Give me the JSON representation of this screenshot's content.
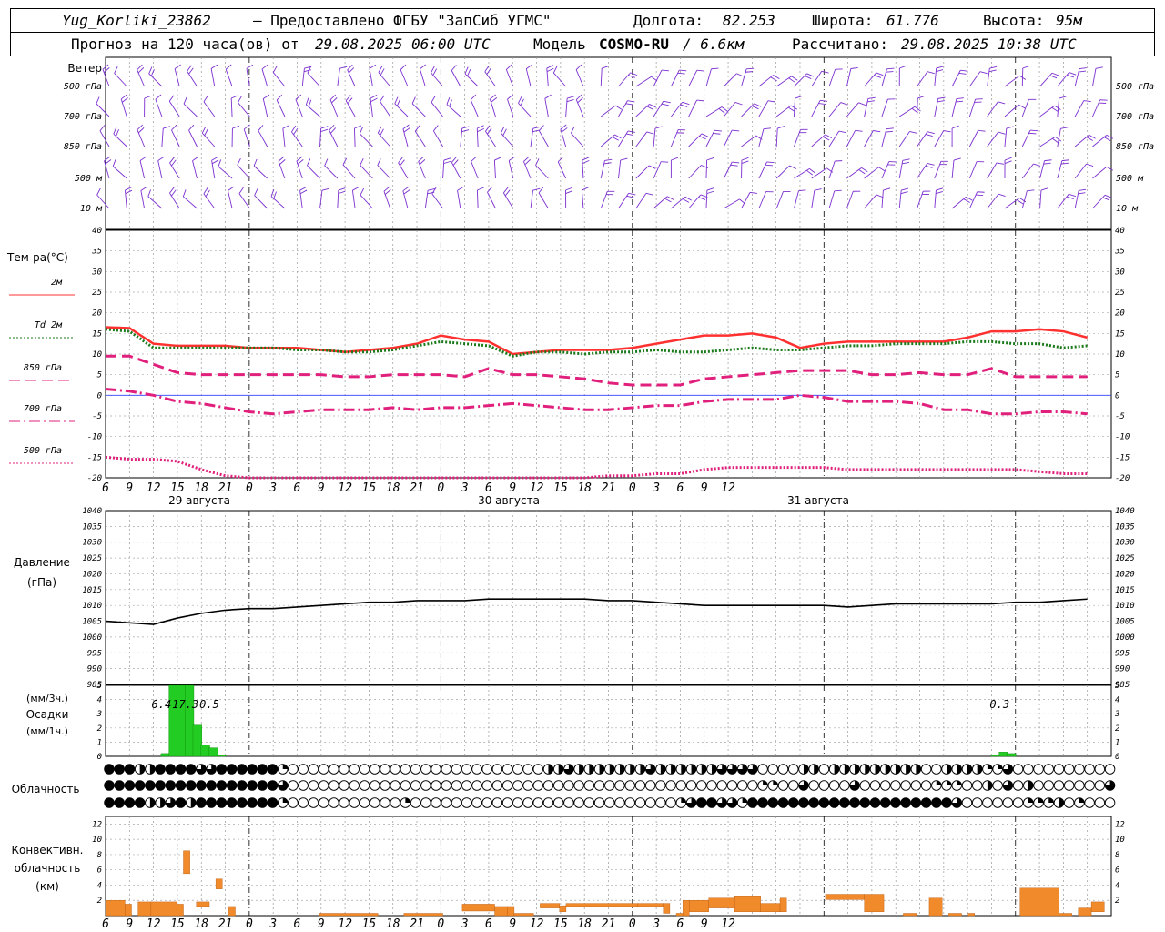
{
  "header": {
    "station": "Yug_Korliki_23862",
    "provider": "– Предоставлено ФГБУ \"ЗапСиб УГМС\"",
    "lon_label": "Долгота:",
    "lon": "82.253",
    "lat_label": "Широта:",
    "lat": "61.776",
    "alt_label": "Высота:",
    "alt": "95м",
    "forecast_prefix": "Прогноз на 120 часа(ов) от",
    "forecast_from": "29.08.2025 06:00 UTC",
    "model_label": "Модель",
    "model": "COSMO-RU",
    "model_res": "/ 6.6км",
    "calc_label": "Рассчитано:",
    "calc_time": "29.08.2025 10:38 UTC"
  },
  "chart_data": [
    {
      "type": "wind-barbs",
      "title": "Ветер",
      "levels": [
        "500 гПа",
        "700 гПа",
        "850 гПа",
        "500 м",
        "10 м"
      ],
      "color": "#7b2fd0"
    },
    {
      "type": "line",
      "ylabel": "Тем-ра(°C)",
      "ylim": [
        -20,
        40
      ],
      "yticks": [
        -20,
        -15,
        -10,
        -5,
        0,
        5,
        10,
        15,
        20,
        25,
        30,
        35,
        40
      ],
      "x_ticks": [
        "6",
        "9",
        "12",
        "15",
        "18",
        "21",
        "0",
        "3",
        "6",
        "9",
        "12",
        "15",
        "18",
        "21",
        "0",
        "3",
        "6",
        "9",
        "12",
        "15",
        "18",
        "21",
        "0",
        "3",
        "6",
        "9",
        "12"
      ],
      "date_labels": [
        "29 августа",
        "30 августа",
        "31 августа"
      ],
      "series": [
        {
          "name": "2м",
          "color": "#ff3030",
          "style": "solid",
          "values": [
            16.5,
            16.3,
            12.5,
            12,
            12,
            12,
            11.5,
            11.5,
            11.5,
            11,
            10.5,
            11,
            11.5,
            12.5,
            14.5,
            13.5,
            13,
            10,
            10.5,
            11,
            11,
            11,
            11.5,
            12.5,
            13.5,
            14.5,
            14.5,
            15,
            14,
            11.5,
            12.5,
            13,
            13,
            13,
            13,
            13,
            14,
            15.5,
            15.5,
            16,
            15.5,
            14
          ]
        },
        {
          "name": "Td 2м",
          "color": "#1a7a1a",
          "style": "dotted",
          "values": [
            16,
            15.5,
            11.5,
            11.5,
            11.5,
            11.5,
            11.5,
            11.5,
            11,
            11,
            10.5,
            10.5,
            11,
            12,
            13,
            12.5,
            12,
            9.5,
            10.5,
            10.5,
            10,
            10.5,
            10.5,
            11,
            10.5,
            10.5,
            11,
            11.5,
            11,
            11,
            11.5,
            12,
            12,
            12.5,
            12.5,
            12.5,
            13,
            13,
            12.5,
            12.5,
            11.5,
            12
          ]
        },
        {
          "name": "850 гПа",
          "color": "#e0207c",
          "style": "dash",
          "values": [
            9.5,
            9.5,
            7.5,
            5.5,
            5,
            5,
            5,
            5,
            5,
            5,
            4.5,
            4.5,
            5,
            5,
            5,
            4.5,
            6.5,
            5,
            5,
            4.5,
            4,
            3,
            2.5,
            2.5,
            2.5,
            4,
            4.5,
            5,
            5.5,
            6,
            6,
            6,
            5,
            5,
            5.5,
            5,
            5,
            6.5,
            4.5,
            4.5,
            4.5,
            4.5
          ]
        },
        {
          "name": "700 гПа",
          "color": "#e0207c",
          "style": "dashdot",
          "values": [
            1.5,
            1,
            0,
            -1.5,
            -2,
            -3,
            -4,
            -4.5,
            -4,
            -3.5,
            -3.5,
            -3.5,
            -3,
            -3.5,
            -3,
            -3,
            -2.5,
            -2,
            -2.5,
            -3,
            -3.5,
            -3.5,
            -3,
            -2.5,
            -2.5,
            -1.5,
            -1,
            -1,
            -1,
            0,
            -0.5,
            -1.5,
            -1.5,
            -1.5,
            -2,
            -3.5,
            -3.5,
            -4.5,
            -4.5,
            -4,
            -4,
            -4.5
          ]
        },
        {
          "name": "500 гПа",
          "color": "#e0207c",
          "style": "dotted",
          "values": [
            -15,
            -15.5,
            -15.5,
            -16,
            -18,
            -19.5,
            -20,
            -20,
            -20,
            -20,
            -20,
            -20,
            -20,
            -20,
            -20,
            -20,
            -20,
            -20,
            -20,
            -20,
            -20,
            -19.5,
            -19.5,
            -19,
            -19,
            -18,
            -17.5,
            -17.5,
            -17.5,
            -17.5,
            -17.5,
            -18,
            -18,
            -18,
            -18,
            -18,
            -18,
            -18,
            -18,
            -18.5,
            -19,
            -19
          ]
        }
      ]
    },
    {
      "type": "line",
      "ylabel": "Давление",
      "yunit": "(гПа)",
      "ylim": [
        985,
        1040
      ],
      "yticks": [
        985,
        990,
        995,
        1000,
        1005,
        1010,
        1015,
        1020,
        1025,
        1030,
        1035,
        1040
      ],
      "series": [
        {
          "name": "Давление",
          "color": "#000000",
          "values": [
            1005,
            1004.5,
            1004,
            1006,
            1007.5,
            1008.5,
            1009,
            1009,
            1009.5,
            1010,
            1010.5,
            1011,
            1011,
            1011.5,
            1011.5,
            1011.5,
            1012,
            1012,
            1012,
            1012,
            1012,
            1011.5,
            1011.5,
            1011,
            1010.5,
            1010,
            1010,
            1010,
            1010,
            1010,
            1010,
            1009.5,
            1010,
            1010.5,
            1010.5,
            1010.5,
            1010.5,
            1010.5,
            1011,
            1011,
            1011.5,
            1012
          ]
        }
      ]
    },
    {
      "type": "bar",
      "ylabel": "(мм/3ч.)",
      "ylabel2": "Осадки",
      "ylabel3": "(мм/1ч.)",
      "ylim": [
        0,
        5
      ],
      "yticks": [
        0,
        1,
        2,
        3,
        4,
        5
      ],
      "color": "#22cc22",
      "annotations": [
        {
          "x_hour": 7.0,
          "text": "6.4"
        },
        {
          "x_hour": 10.0,
          "text": "17.3"
        },
        {
          "x_hour": 13.0,
          "text": "0.5"
        },
        {
          "x_hour": 112.0,
          "text": "0.3"
        }
      ],
      "bars": [
        {
          "h": 7,
          "v": 0.2
        },
        {
          "h": 8,
          "v": 5
        },
        {
          "h": 9,
          "v": 5
        },
        {
          "h": 10,
          "v": 5
        },
        {
          "h": 11,
          "v": 2.2
        },
        {
          "h": 12,
          "v": 0.8
        },
        {
          "h": 13,
          "v": 0.6
        },
        {
          "h": 14,
          "v": 0.1
        },
        {
          "h": 111,
          "v": 0.1
        },
        {
          "h": 112,
          "v": 0.3
        },
        {
          "h": 113,
          "v": 0.2
        }
      ]
    },
    {
      "type": "cloud-cover",
      "ylabel": "Облачность",
      "rows": [
        [
          8,
          8,
          8,
          4,
          4,
          8,
          8,
          8,
          8,
          6,
          6,
          8,
          8,
          8,
          8,
          8,
          8,
          2,
          0,
          0,
          0,
          0,
          0,
          0,
          0,
          0,
          0,
          0,
          0,
          0,
          0,
          0,
          0,
          0,
          0,
          0,
          0,
          0,
          0,
          0,
          0,
          0,
          0,
          4,
          4,
          6,
          4,
          4,
          4,
          4,
          4,
          4,
          4,
          6,
          4,
          4,
          4,
          4,
          4,
          4,
          6,
          6,
          6,
          6,
          0,
          0,
          0,
          0,
          4,
          4,
          0,
          4,
          4,
          4,
          4,
          4,
          4,
          4,
          4,
          4,
          0,
          0,
          4,
          4,
          4,
          4,
          2,
          2,
          6,
          0,
          0,
          0,
          0,
          0,
          0,
          0,
          0,
          0,
          0
        ],
        [
          8,
          8,
          8,
          8,
          8,
          8,
          8,
          8,
          8,
          8,
          8,
          8,
          8,
          8,
          8,
          8,
          8,
          6,
          0,
          0,
          0,
          0,
          0,
          0,
          0,
          0,
          0,
          0,
          0,
          0,
          0,
          0,
          0,
          0,
          0,
          0,
          0,
          0,
          0,
          0,
          0,
          0,
          0,
          0,
          0,
          0,
          0,
          0,
          0,
          0,
          0,
          0,
          0,
          0,
          0,
          0,
          0,
          0,
          0,
          0,
          0,
          0,
          0,
          0,
          2,
          2,
          0,
          0,
          6,
          0,
          0,
          0,
          0,
          6,
          0,
          0,
          0,
          0,
          0,
          0,
          0,
          2,
          2,
          2,
          0,
          0,
          4,
          0,
          6,
          0,
          4,
          0,
          0,
          0,
          0,
          0,
          0,
          0,
          6
        ],
        [
          8,
          8,
          8,
          8,
          4,
          4,
          6,
          8,
          4,
          8,
          8,
          8,
          8,
          8,
          8,
          8,
          8,
          2,
          0,
          0,
          0,
          0,
          0,
          0,
          0,
          0,
          0,
          0,
          0,
          2,
          0,
          0,
          0,
          0,
          0,
          0,
          0,
          0,
          0,
          0,
          0,
          0,
          0,
          0,
          0,
          0,
          0,
          0,
          0,
          0,
          0,
          0,
          0,
          0,
          0,
          0,
          2,
          6,
          8,
          8,
          6,
          6,
          2,
          8,
          8,
          8,
          8,
          8,
          8,
          8,
          8,
          8,
          8,
          8,
          8,
          8,
          8,
          8,
          8,
          8,
          8,
          8,
          8,
          6,
          0,
          0,
          0,
          0,
          0,
          0,
          2,
          2,
          2,
          4,
          0,
          2,
          0,
          0,
          0
        ]
      ]
    },
    {
      "type": "bar",
      "ylabel": "Конвективн.",
      "ylabel2": "облачность",
      "ylabel3": "(км)",
      "ylim": [
        0,
        13
      ],
      "yticks": [
        2,
        4,
        6,
        8,
        10,
        12
      ],
      "color": "#f08a2a",
      "bars": [
        {
          "h0": 0,
          "h1": 3,
          "lo": 0,
          "hi": 2
        },
        {
          "h0": 3,
          "h1": 4,
          "lo": 0,
          "hi": 1.5
        },
        {
          "h0": 5,
          "h1": 7,
          "lo": 0,
          "hi": 1.8
        },
        {
          "h0": 7,
          "h1": 11,
          "lo": 0,
          "hi": 1.8
        },
        {
          "h0": 11,
          "h1": 12,
          "lo": 0,
          "hi": 1.5
        },
        {
          "h0": 12,
          "h1": 13,
          "lo": 5.5,
          "hi": 8.5
        },
        {
          "h0": 14,
          "h1": 16,
          "lo": 1.2,
          "hi": 1.8
        },
        {
          "h0": 17,
          "h1": 18,
          "lo": 3.5,
          "hi": 4.8
        },
        {
          "h0": 19,
          "h1": 20,
          "lo": 0,
          "hi": 1.2
        },
        {
          "h0": 33,
          "h1": 42,
          "lo": 0,
          "hi": 0.3
        },
        {
          "h0": 46,
          "h1": 52,
          "lo": 0,
          "hi": 0.3
        },
        {
          "h0": 55,
          "h1": 60,
          "lo": 0.6,
          "hi": 1.5
        },
        {
          "h0": 60,
          "h1": 62,
          "lo": 0,
          "hi": 1.2
        },
        {
          "h0": 62,
          "h1": 63,
          "lo": 0,
          "hi": 1.2
        },
        {
          "h0": 63,
          "h1": 66,
          "lo": 0,
          "hi": 0.3
        },
        {
          "h0": 67,
          "h1": 70,
          "lo": 1,
          "hi": 1.6
        },
        {
          "h0": 70,
          "h1": 71,
          "lo": 0.5,
          "hi": 1.3
        },
        {
          "h0": 71,
          "h1": 82,
          "lo": 1.2,
          "hi": 1.6
        },
        {
          "h0": 82,
          "h1": 86,
          "lo": 1.2,
          "hi": 1.6
        },
        {
          "h0": 86,
          "h1": 87,
          "lo": 0.3,
          "hi": 1.6
        },
        {
          "h0": 88,
          "h1": 89,
          "lo": 0,
          "hi": 0.3
        },
        {
          "h0": 89,
          "h1": 90,
          "lo": 0,
          "hi": 2
        },
        {
          "h0": 90,
          "h1": 93,
          "lo": 0.5,
          "hi": 2
        },
        {
          "h0": 93,
          "h1": 97,
          "lo": 1,
          "hi": 2.3
        },
        {
          "h0": 97,
          "h1": 101,
          "lo": 0.5,
          "hi": 2.6
        },
        {
          "h0": 101,
          "h1": 104,
          "lo": 0.5,
          "hi": 1.6
        },
        {
          "h0": 104,
          "h1": 105,
          "lo": 0.5,
          "hi": 2.3
        },
        {
          "h0": 111,
          "h1": 117,
          "lo": 2.1,
          "hi": 2.8
        },
        {
          "h0": 117,
          "h1": 120,
          "lo": 0.5,
          "hi": 2.8
        },
        {
          "h0": 123,
          "h1": 125,
          "lo": 0,
          "hi": 0.3
        },
        {
          "h0": 127,
          "h1": 129,
          "lo": 0,
          "hi": 2.3
        },
        {
          "h0": 130,
          "h1": 132,
          "lo": 0,
          "hi": 0.3
        },
        {
          "h0": 133,
          "h1": 134,
          "lo": 0,
          "hi": 0.3
        },
        {
          "h0": 141,
          "h1": 147,
          "lo": 0,
          "hi": 3.6
        },
        {
          "h0": 147,
          "h1": 149,
          "lo": 0,
          "hi": 0.3
        },
        {
          "h0": 150,
          "h1": 152,
          "lo": 0,
          "hi": 1
        },
        {
          "h0": 152,
          "h1": 154,
          "lo": 0.5,
          "hi": 1.8
        }
      ]
    }
  ]
}
